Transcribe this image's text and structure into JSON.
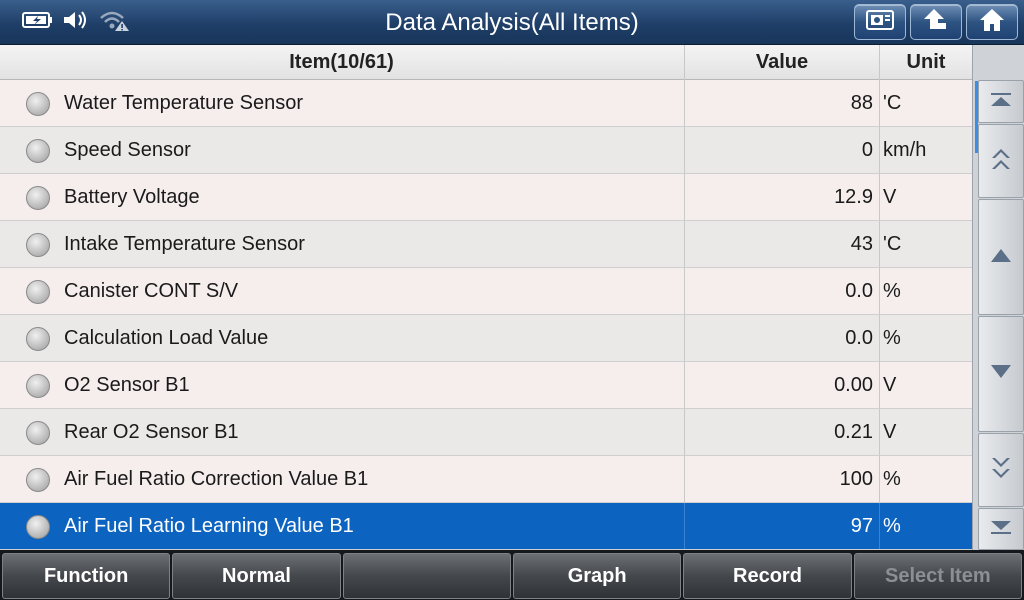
{
  "header": {
    "title": "Data Analysis(All Items)",
    "status_icons": [
      "battery-icon",
      "speaker-icon",
      "wifi-warning-icon"
    ],
    "nav_buttons": [
      "screenshot-icon",
      "back-icon",
      "home-icon"
    ]
  },
  "table": {
    "columns": {
      "item": "Item(10/61)",
      "value": "Value",
      "unit": "Unit"
    },
    "rows": [
      {
        "name": "Water Temperature Sensor",
        "value": "88",
        "unit": "'C"
      },
      {
        "name": "Speed Sensor",
        "value": "0",
        "unit": "km/h"
      },
      {
        "name": "Battery Voltage",
        "value": "12.9",
        "unit": "V"
      },
      {
        "name": "Intake Temperature Sensor",
        "value": "43",
        "unit": "'C"
      },
      {
        "name": "Canister CONT S/V",
        "value": "0.0",
        "unit": "%"
      },
      {
        "name": "Calculation Load Value",
        "value": "0.0",
        "unit": "%"
      },
      {
        "name": "O2 Sensor B1",
        "value": "0.00",
        "unit": "V"
      },
      {
        "name": "Rear O2 Sensor B1",
        "value": "0.21",
        "unit": "V"
      },
      {
        "name": "Air Fuel Ratio Correction Value B1",
        "value": "100",
        "unit": "%"
      },
      {
        "name": "Air Fuel Ratio Learning Value B1",
        "value": "97",
        "unit": "%"
      }
    ],
    "selected_row": 9
  },
  "scroll": {
    "buttons": [
      "scroll-top-icon",
      "page-up-icon",
      "line-up-icon",
      "line-down-icon",
      "page-down-icon",
      "scroll-bottom-icon"
    ]
  },
  "footer": {
    "buttons": [
      {
        "label": "Function",
        "enabled": true
      },
      {
        "label": "Normal",
        "enabled": true
      },
      {
        "label": "",
        "enabled": true
      },
      {
        "label": "Graph",
        "enabled": true
      },
      {
        "label": "Record",
        "enabled": true
      },
      {
        "label": "Select Item",
        "enabled": false
      }
    ]
  },
  "colors": {
    "header": "#1f3f68",
    "selected_row": "#0d63c0",
    "row_odd": "#f6eded",
    "row_even": "#ebe8e8"
  }
}
